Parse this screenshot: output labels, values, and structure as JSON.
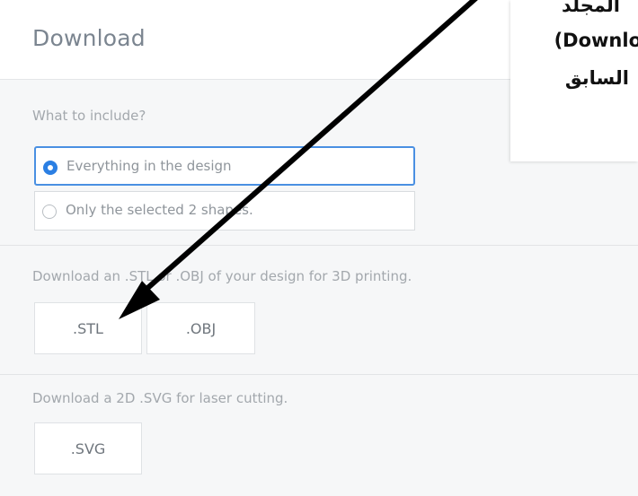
{
  "panel": {
    "title": "Download",
    "include_label": "What to include?",
    "options": [
      {
        "label": "Everything in the design",
        "selected": true
      },
      {
        "label": "Only the selected 2 shapes.",
        "selected": false
      }
    ],
    "print_label": "Download an .STL or .OBJ of your design for 3D printing.",
    "print_buttons": [
      ".STL",
      ".OBJ"
    ],
    "laser_label": "Download a 2D .SVG for laser cutting.",
    "laser_buttons": [
      ".SVG"
    ]
  },
  "callout": {
    "lines": [
      "المجلد",
      "(Downlo",
      "السابق"
    ]
  },
  "colors": {
    "accent": "#2b7fe3",
    "arrow": "#000000"
  }
}
